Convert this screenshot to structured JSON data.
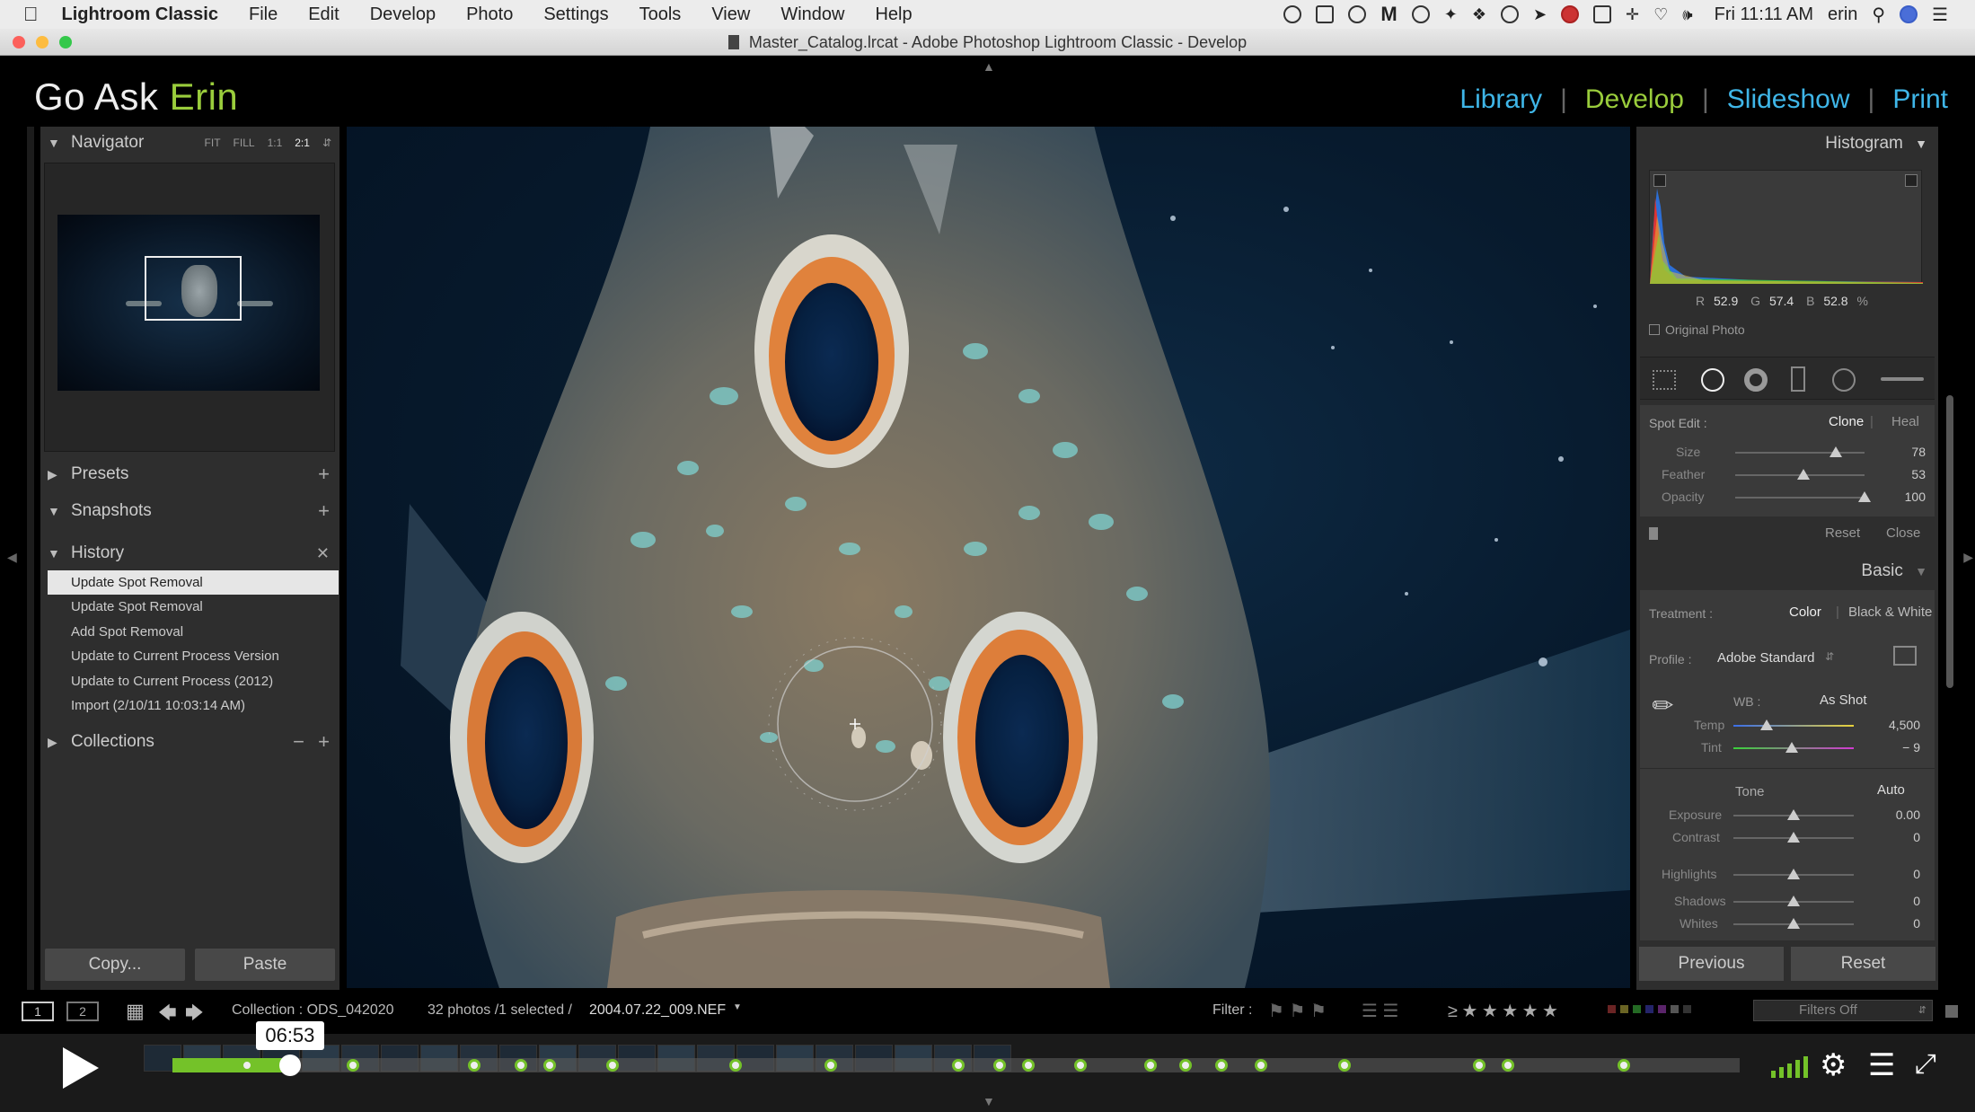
{
  "menubar": {
    "app_name": "Lightroom Classic",
    "items": [
      "File",
      "Edit",
      "Develop",
      "Photo",
      "Settings",
      "Tools",
      "View",
      "Window",
      "Help"
    ],
    "clock": "Fri 11:11 AM",
    "user": "erin"
  },
  "window": {
    "title": "Master_Catalog.lrcat - Adobe Photoshop Lightroom Classic - Develop"
  },
  "identity": {
    "first": "Go Ask",
    "second": "Erin"
  },
  "modules": {
    "library": "Library",
    "develop": "Develop",
    "slideshow": "Slideshow",
    "print": "Print",
    "sep": "|",
    "active_color": "#9acd3c",
    "inactive_color": "#3fb6e8"
  },
  "left": {
    "navigator": {
      "title": "Navigator",
      "fit": "FIT",
      "fill": "FILL",
      "one": "1:1",
      "two": "2:1"
    },
    "presets": "Presets",
    "snapshots": "Snapshots",
    "history": {
      "title": "History",
      "items": [
        "Update Spot Removal",
        "Update Spot Removal",
        "Add Spot Removal",
        "Update to Current Process Version",
        "Update to Current Process (2012)",
        "Import (2/10/11 10:03:14 AM)"
      ]
    },
    "collections": "Collections",
    "copy": "Copy...",
    "paste": "Paste"
  },
  "right": {
    "histogram": {
      "title": "Histogram",
      "r_label": "R",
      "r": "52.9",
      "g_label": "G",
      "g": "57.4",
      "b_label": "B",
      "b": "52.8",
      "pct": "%",
      "original_photo": "Original Photo"
    },
    "spot": {
      "label": "Spot Edit :",
      "clone": "Clone",
      "heal": "Heal",
      "size_label": "Size",
      "size": "78",
      "size_level": 0.78,
      "feather_label": "Feather",
      "feather": "53",
      "feather_level": 0.53,
      "opacity_label": "Opacity",
      "opacity": "100",
      "opacity_level": 1.0,
      "reset": "Reset",
      "close": "Close"
    },
    "basic": {
      "title": "Basic",
      "treatment_label": "Treatment :",
      "color": "Color",
      "bw": "Black & White",
      "profile_label": "Profile :",
      "profile": "Adobe Standard",
      "wb_label": "WB :",
      "wb": "As Shot",
      "temp_label": "Temp",
      "temp": "4,500",
      "tint_label": "Tint",
      "tint": "− 9",
      "tone": "Tone",
      "auto": "Auto",
      "exposure_label": "Exposure",
      "exposure": "0.00",
      "contrast_label": "Contrast",
      "contrast": "0",
      "highlights_label": "Highlights",
      "highlights": "0",
      "shadows_label": "Shadows",
      "shadows": "0",
      "whites_label": "Whites",
      "whites": "0"
    },
    "previous": "Previous",
    "reset": "Reset"
  },
  "toolbar": {
    "view1": "1",
    "view2": "2",
    "collection": "Collection : ODS_042020",
    "count": "32 photos /1 selected /",
    "filename": "2004.07.22_009.NEF",
    "filter_label": "Filter :",
    "filters_off": "Filters Off"
  },
  "player": {
    "time": "06:53",
    "progress": 0.075
  }
}
